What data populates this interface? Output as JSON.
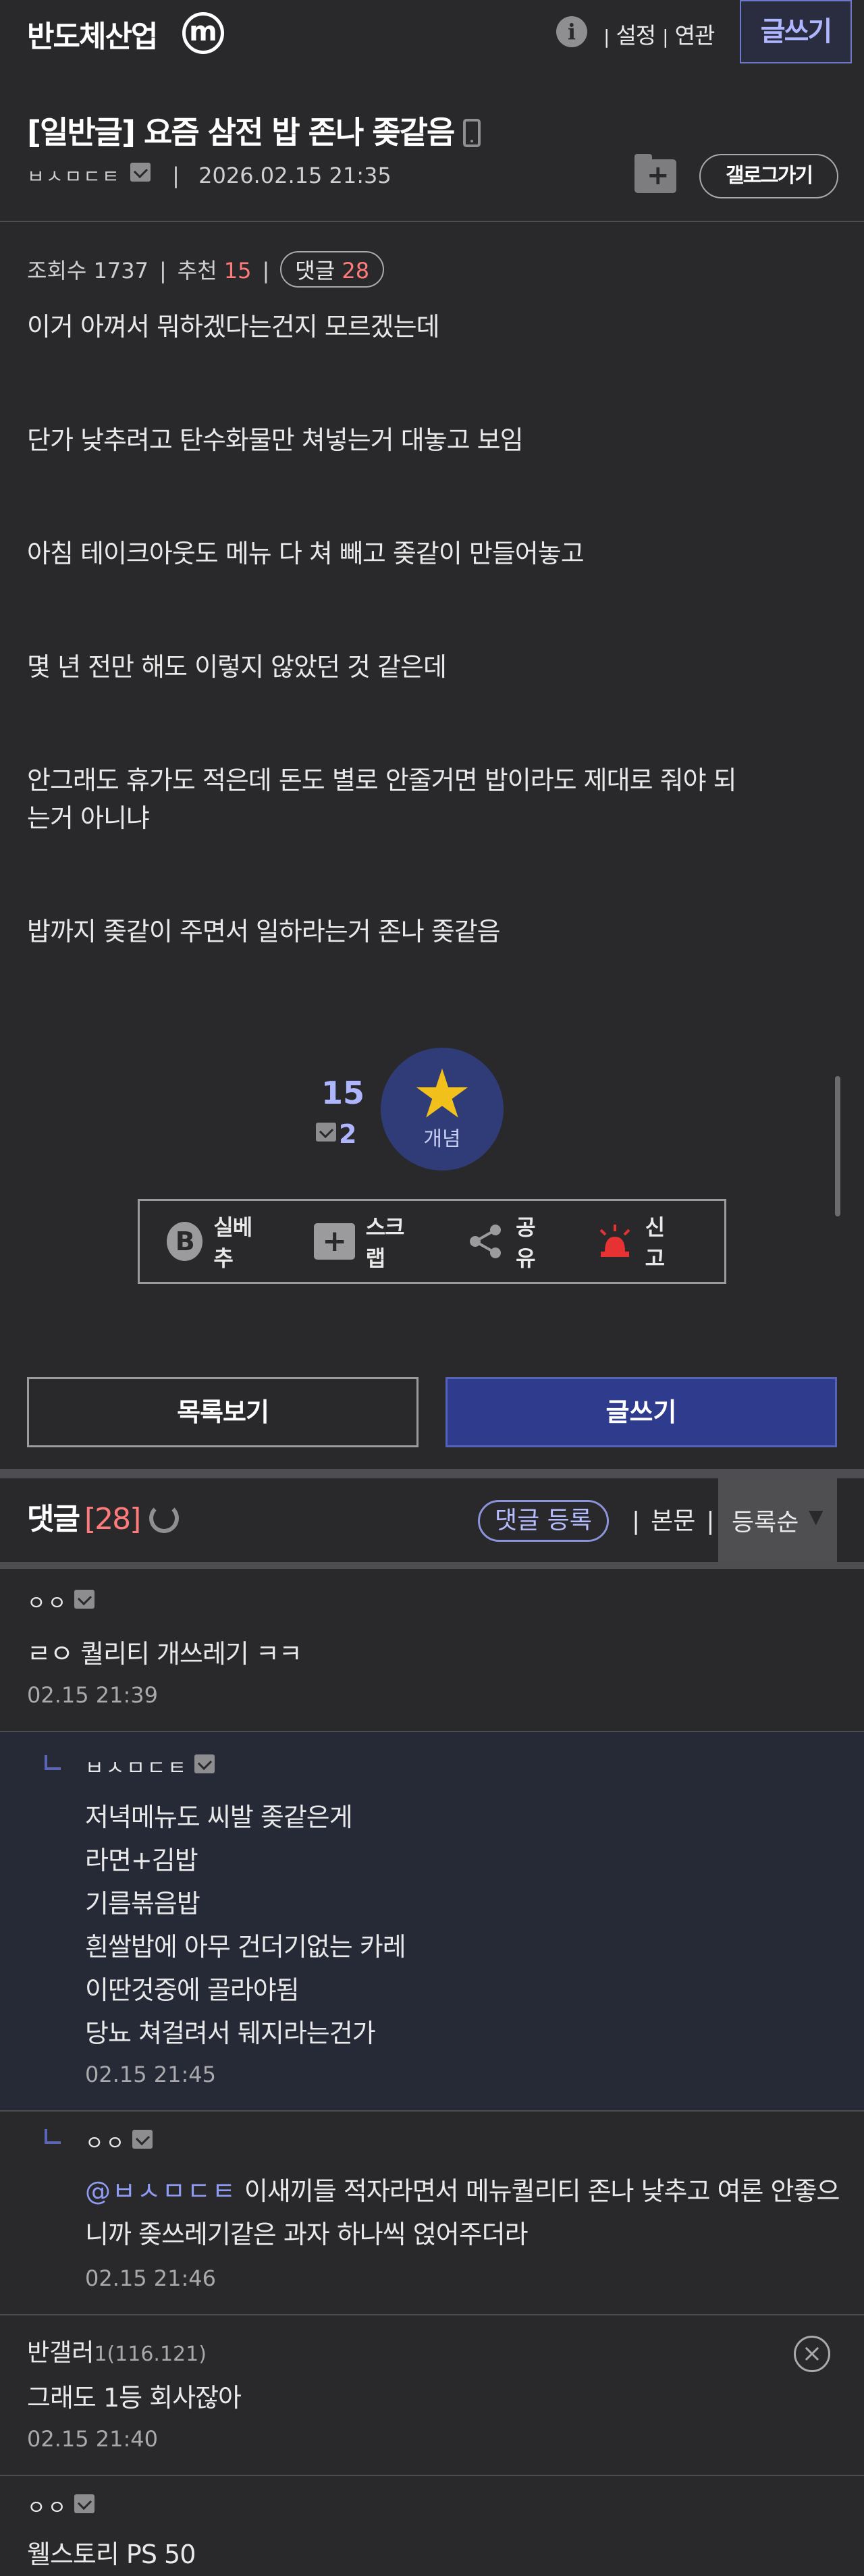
{
  "header": {
    "gallery_name": "반도체산업",
    "minor_badge": "m",
    "links": [
      "설정",
      "연관"
    ],
    "write_label": "글쓰기"
  },
  "post": {
    "title": "[일반글] 요즘 삼전 밥 존나 좆같음",
    "author": "ㅂㅅㅁㄷㅌ",
    "datetime": "2026.02.15 21:35",
    "gallog_label": "갤로그가기",
    "views_label": "조회수 1737",
    "recommend_label": "추천",
    "recommend_value": "15",
    "comment_label": "댓글",
    "comment_value": "28",
    "body": [
      "이거 아껴서 뭐하겠다는건지 모르겠는데",
      "",
      "단가 낮추려고 탄수화물만 쳐넣는거 대놓고 보임",
      "",
      "아침 테이크아웃도 메뉴 다 쳐 빼고 좆같이 만들어놓고",
      "",
      "몇 년 전만 해도 이렇지 않았던 것 같은데",
      "",
      "안그래도 휴가도 적은데 돈도 별로 안줄거면 밥이라도 제대로 줘야 되",
      "는거 아니냐",
      "",
      "밥까지 좆같이 주면서 일하라는거 존나 좆같음"
    ]
  },
  "recommend": {
    "count": "15",
    "fix_count": "2",
    "star_label": "개념"
  },
  "actions": [
    "실베추",
    "스크랩",
    "공유",
    "신고"
  ],
  "buttons": {
    "list": "목록보기",
    "write": "글쓰기"
  },
  "comments_section": {
    "title": "댓글",
    "count": "[28]",
    "register": "댓글 등록",
    "body_link": "본문",
    "sort": "등록순"
  },
  "comments": [
    {
      "nick": "ㅇㅇ",
      "text": "ㄹㅇ 퀄리티 개쓰레기 ㅋㅋ",
      "time": "02.15 21:39"
    },
    {
      "nick": "ㅂㅅㅁㄷㅌ",
      "lines": [
        "저녁메뉴도 씨발 좆같은게",
        "라면+김밥",
        "기름볶음밥",
        "흰쌀밥에 아무 건더기없는 카레",
        "이딴것중에 골라야됨",
        "당뇨 쳐걸려서 뒈지라는건가"
      ],
      "time": "02.15 21:45"
    },
    {
      "nick": "ㅇㅇ",
      "mention": "@ㅂㅅㅁㄷㅌ",
      "text1": " 이새끼들 적자라면서 메뉴퀄리티 존나 낮추고 여론 안좋으",
      "text2": "니까 좆쓰레기같은 과자 하나씩 얹어주더라",
      "time": "02.15 21:46"
    },
    {
      "nick": "반갤러",
      "ip": "1(116.121)",
      "text": "그래도 1등 회사잖아",
      "time": "02.15 21:40"
    },
    {
      "nick": "ㅇㅇ",
      "text": "웰스토리 PS 50"
    }
  ]
}
